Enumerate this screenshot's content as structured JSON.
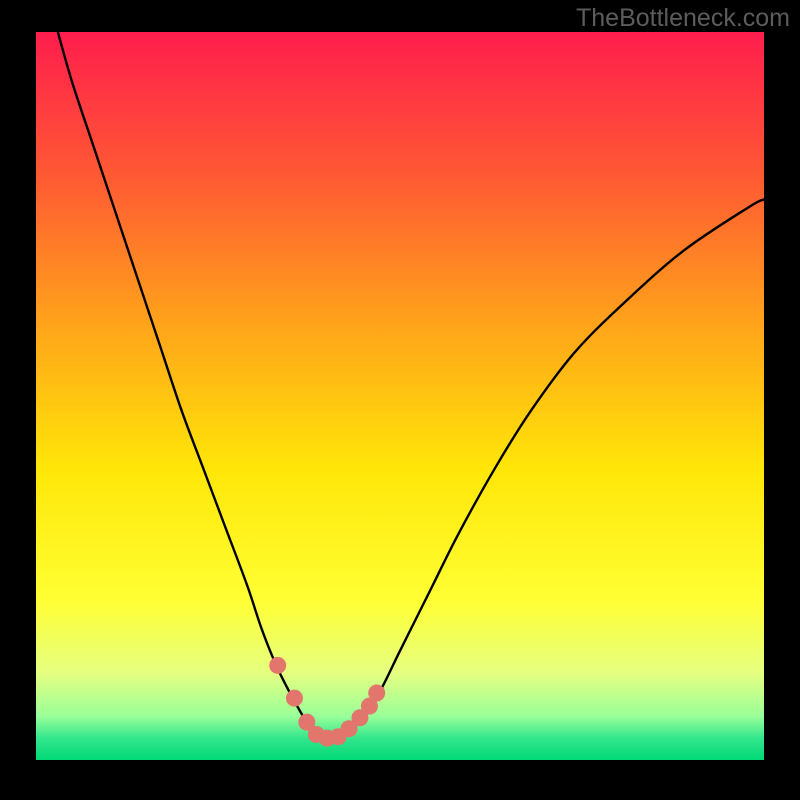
{
  "watermark": "TheBottleneck.com",
  "chart_data": {
    "type": "line",
    "title": "",
    "xlabel": "",
    "ylabel": "",
    "xlim": [
      0,
      100
    ],
    "ylim": [
      0,
      100
    ],
    "background": {
      "type": "vertical-gradient",
      "stops": [
        {
          "offset": 0,
          "color": "#ff1d4d"
        },
        {
          "offset": 20,
          "color": "#ff5a33"
        },
        {
          "offset": 40,
          "color": "#ffa31a"
        },
        {
          "offset": 60,
          "color": "#ffe608"
        },
        {
          "offset": 78,
          "color": "#ffff33"
        },
        {
          "offset": 88,
          "color": "#e6ff80"
        },
        {
          "offset": 94,
          "color": "#99ff99"
        },
        {
          "offset": 97,
          "color": "#33e68c"
        },
        {
          "offset": 100,
          "color": "#00d977"
        }
      ]
    },
    "series": [
      {
        "name": "curve",
        "type": "line",
        "x": [
          3,
          5,
          8,
          11,
          14,
          17,
          20,
          23,
          26,
          29,
          31,
          33,
          35,
          37,
          38.5,
          40,
          42,
          44,
          47,
          50,
          54,
          58,
          63,
          68,
          74,
          81,
          89,
          98,
          100
        ],
        "y": [
          100,
          93,
          84,
          75,
          66,
          57,
          48,
          40,
          32,
          24,
          18,
          13,
          9,
          5.5,
          3.5,
          3,
          3.3,
          5,
          9,
          15,
          23,
          31,
          40,
          48,
          56,
          63,
          70,
          76,
          77
        ]
      },
      {
        "name": "highlight-dots",
        "type": "scatter",
        "color": "#e2766d",
        "x": [
          33.2,
          35.5,
          37.2,
          38.5,
          40.0,
          41.5,
          43.0,
          44.5,
          45.8,
          46.8
        ],
        "y": [
          13.0,
          8.5,
          5.2,
          3.5,
          3.0,
          3.2,
          4.3,
          5.8,
          7.4,
          9.2
        ]
      }
    ]
  }
}
